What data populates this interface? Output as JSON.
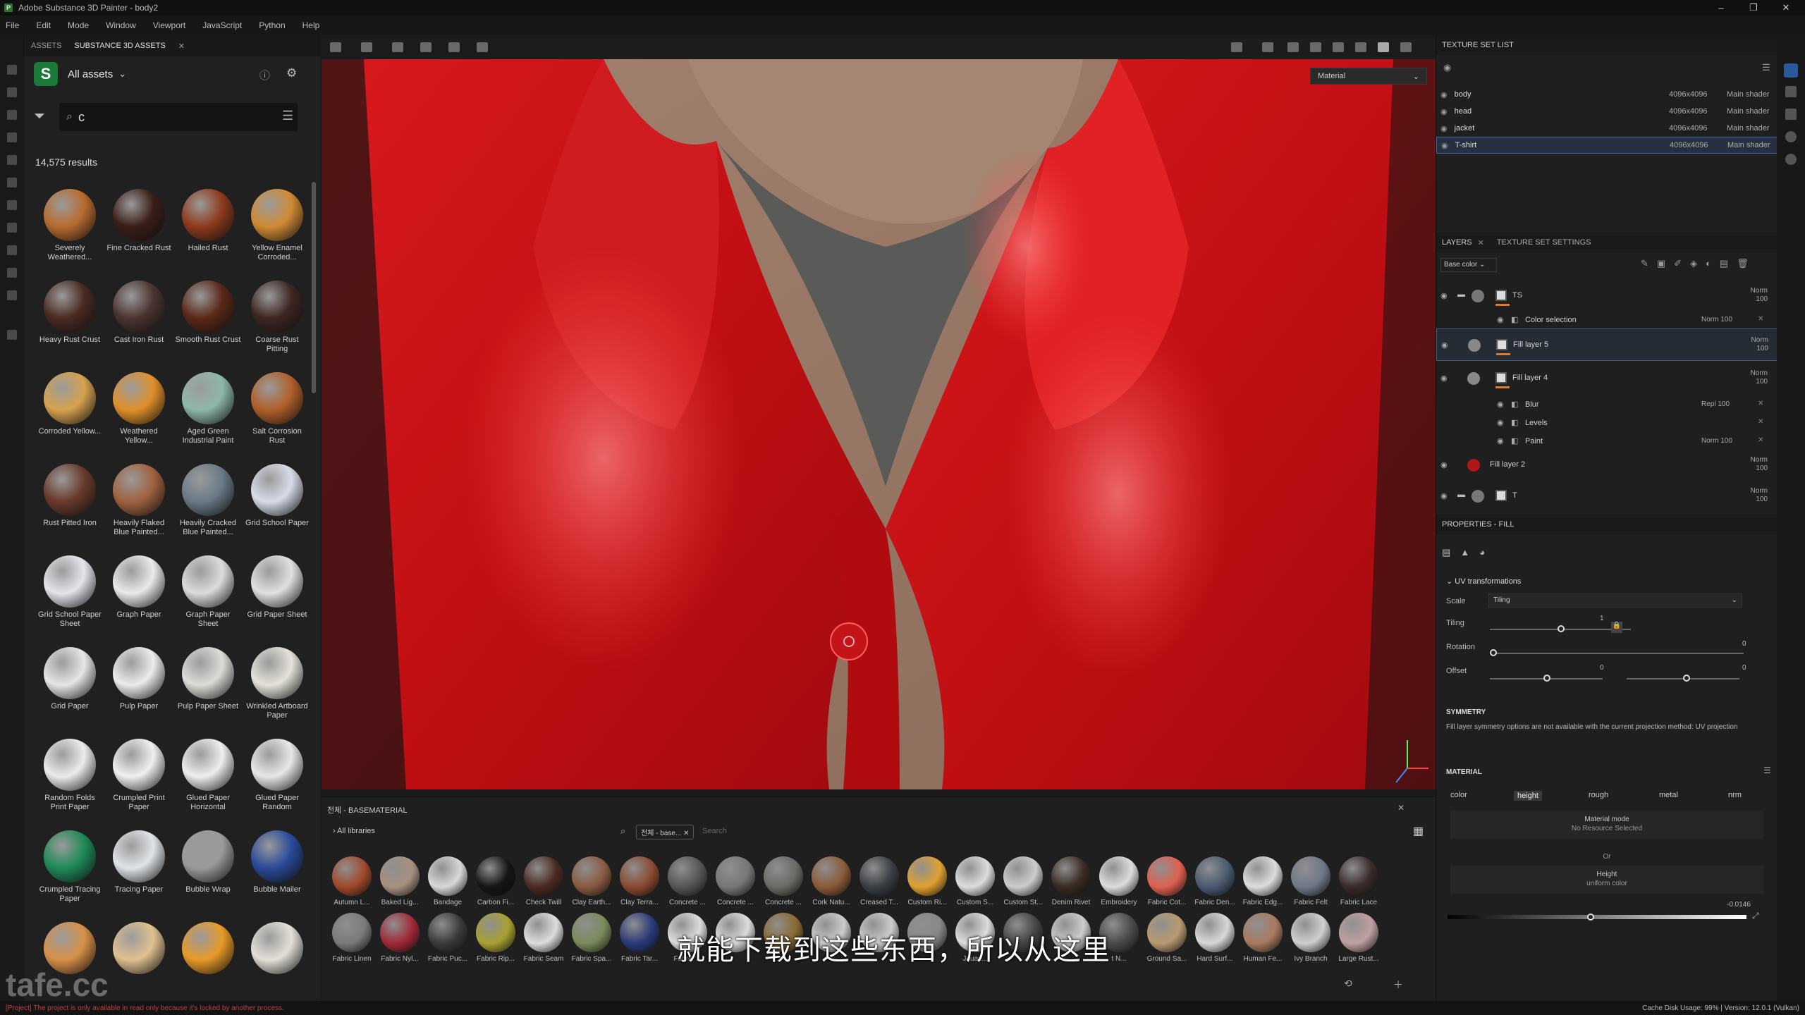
{
  "window": {
    "title": "Adobe Substance 3D Painter - body2"
  },
  "menu": [
    "File",
    "Edit",
    "Mode",
    "Window",
    "Viewport",
    "JavaScript",
    "Python",
    "Help"
  ],
  "assets_panel": {
    "tabs": [
      "ASSETS",
      "SUBSTANCE 3D ASSETS"
    ],
    "library_label": "All assets",
    "search_value": "c",
    "results": "14,575 results",
    "items": [
      {
        "label": "Severely Weathered...",
        "color": "#b86b2e"
      },
      {
        "label": "Fine Cracked Rust",
        "color": "#3a1e18"
      },
      {
        "label": "Hailed Rust",
        "color": "#8e3a1c"
      },
      {
        "label": "Yellow Enamel Corroded...",
        "color": "#d08a34"
      },
      {
        "label": "Heavy Rust Crust",
        "color": "#4a2a22"
      },
      {
        "label": "Cast Iron Rust",
        "color": "#4b3430"
      },
      {
        "label": "Smooth Rust Crust",
        "color": "#5a2818"
      },
      {
        "label": "Coarse Rust Pitting",
        "color": "#3e2622"
      },
      {
        "label": "Corroded Yellow...",
        "color": "#d6a24e"
      },
      {
        "label": "Weathered Yellow...",
        "color": "#e0902a"
      },
      {
        "label": "Aged Green Industrial Paint",
        "color": "#8fb8a8"
      },
      {
        "label": "Salt Corrosion Rust",
        "color": "#b0602a"
      },
      {
        "label": "Rust Pitted Iron",
        "color": "#6a3a2c"
      },
      {
        "label": "Heavily Flaked Blue Painted...",
        "color": "#a06240"
      },
      {
        "label": "Heavily Cracked Blue Painted...",
        "color": "#6a7a88"
      },
      {
        "label": "Grid School Paper",
        "color": "#d8dce8"
      },
      {
        "label": "Grid School Paper Sheet",
        "color": "#e4e6ec"
      },
      {
        "label": "Graph Paper",
        "color": "#e8eaec"
      },
      {
        "label": "Graph Paper Sheet",
        "color": "#dcdcdc"
      },
      {
        "label": "Grid Paper Sheet",
        "color": "#e0e0e0"
      },
      {
        "label": "Grid Paper",
        "color": "#e6e6e6"
      },
      {
        "label": "Pulp Paper",
        "color": "#ececec"
      },
      {
        "label": "Pulp Paper Sheet",
        "color": "#dedcd8"
      },
      {
        "label": "Wrinkled Artboard Paper",
        "color": "#e4e2da"
      },
      {
        "label": "Random Folds Print Paper",
        "color": "#ececec"
      },
      {
        "label": "Crumpled Print Paper",
        "color": "#f0f0f0"
      },
      {
        "label": "Glued Paper Horizontal",
        "color": "#eeeeee"
      },
      {
        "label": "Glued Paper Random",
        "color": "#e8e8e8"
      },
      {
        "label": "Crumpled Tracing Paper",
        "color": "#1f8a58"
      },
      {
        "label": "Tracing Paper",
        "color": "#e0e4e8"
      },
      {
        "label": "Bubble Wrap",
        "color": "#9a9a9a"
      },
      {
        "label": "Bubble Mailer",
        "color": "#2a4a9a"
      },
      {
        "label": "",
        "color": "#d89048"
      },
      {
        "label": "",
        "color": "#e0c090"
      },
      {
        "label": "",
        "color": "#e89a28"
      },
      {
        "label": "",
        "color": "#e4e0d8"
      }
    ]
  },
  "viewport": {
    "material_dropdown": "Material",
    "subtitle": "就能下载到这些东西，所以从这里"
  },
  "shelf": {
    "title": "전체 - BASEMATERIAL",
    "libraries": "All libraries",
    "filter_chip": "전체 - base...",
    "search_placeholder": "Search",
    "row1": [
      {
        "label": "Autumn L...",
        "color": "#a0482a"
      },
      {
        "label": "Baked Lig...",
        "color": "#a89080"
      },
      {
        "label": "Bandage",
        "color": "#d8d8d8"
      },
      {
        "label": "Carbon Fi...",
        "color": "#141414"
      },
      {
        "label": "Check Twill",
        "color": "#4a2a22"
      },
      {
        "label": "Clay Earth...",
        "color": "#8a5a40"
      },
      {
        "label": "Clay Terra...",
        "color": "#8a4a30"
      },
      {
        "label": "Concrete ...",
        "color": "#555555"
      },
      {
        "label": "Concrete ...",
        "color": "#777777"
      },
      {
        "label": "Concrete ...",
        "color": "#6a6a66"
      },
      {
        "label": "Cork Natu...",
        "color": "#8a5a38"
      },
      {
        "label": "Creased T...",
        "color": "#3a3e44"
      },
      {
        "label": "Custom Ri...",
        "color": "#e0a030"
      },
      {
        "label": "Custom S...",
        "color": "#dddddd"
      },
      {
        "label": "Custom St...",
        "color": "#cccccc"
      },
      {
        "label": "Denim Rivet",
        "color": "#3a2a22"
      },
      {
        "label": "Embroidery",
        "color": "#dddddd"
      },
      {
        "label": "Fabric Cot...",
        "color": "#e06050"
      },
      {
        "label": "Fabric Den...",
        "color": "#4a5a70"
      },
      {
        "label": "Fabric Edg...",
        "color": "#dddddd"
      },
      {
        "label": "Fabric Felt",
        "color": "#707888"
      },
      {
        "label": "Fabric Lace",
        "color": "#3a2a2a"
      }
    ],
    "row2": [
      {
        "label": "Fabric Linen",
        "color": "#7a7a78"
      },
      {
        "label": "Fabric Nyl...",
        "color": "#a02838"
      },
      {
        "label": "Fabric Puc...",
        "color": "#3a3a3a"
      },
      {
        "label": "Fabric Rip...",
        "color": "#a8a030"
      },
      {
        "label": "Fabric Seam",
        "color": "#dddddd"
      },
      {
        "label": "Fabric Spa...",
        "color": "#7a8a5a"
      },
      {
        "label": "Fabric Tar...",
        "color": "#2a3a7a"
      },
      {
        "label": "Fabric ...",
        "color": "#dddddd"
      },
      {
        "label": "",
        "color": "#dddddd"
      },
      {
        "label": "",
        "color": "#8a6a30"
      },
      {
        "label": "",
        "color": "#cccccc"
      },
      {
        "label": "",
        "color": "#cccccc"
      },
      {
        "label": "",
        "color": "#888888"
      },
      {
        "label": "Jouac...",
        "color": "#dddddd"
      },
      {
        "label": "",
        "color": "#444444"
      },
      {
        "label": "",
        "color": "#cccccc"
      },
      {
        "label": "t N...",
        "color": "#4a4a4a"
      },
      {
        "label": "Ground Sa...",
        "color": "#b89a70"
      },
      {
        "label": "Hard Surf...",
        "color": "#d8d8d8"
      },
      {
        "label": "Human Fe...",
        "color": "#a87a60"
      },
      {
        "label": "Ivy Branch",
        "color": "#cfcfcf"
      },
      {
        "label": "Large Rust...",
        "color": "#c0a0a0"
      }
    ]
  },
  "texture_set_list": {
    "title": "TEXTURE SET LIST",
    "rows": [
      {
        "name": "body",
        "res": "4096x4096",
        "shader": "Main shader"
      },
      {
        "name": "head",
        "res": "4096x4096",
        "shader": "Main shader"
      },
      {
        "name": "jacket",
        "res": "4096x4096",
        "shader": "Main shader"
      },
      {
        "name": "T-shirt",
        "res": "4096x4096",
        "shader": "Main shader"
      }
    ]
  },
  "layers": {
    "tabs": [
      "LAYERS",
      "TEXTURE SET SETTINGS"
    ],
    "channel": "Base color",
    "rows": [
      {
        "name": "TS",
        "blend": "Norm",
        "opacity": "100"
      },
      {
        "name": "Color selection",
        "blend": "Norm",
        "opacity": "100"
      },
      {
        "name": "Fill layer 5",
        "blend": "Norm",
        "opacity": "100"
      },
      {
        "name": "Fill layer 4",
        "blend": "Norm",
        "opacity": "100"
      },
      {
        "name": "Blur",
        "blend": "Repl",
        "opacity": "100"
      },
      {
        "name": "Levels",
        "blend": "",
        "opacity": ""
      },
      {
        "name": "Paint",
        "blend": "Norm",
        "opacity": "100"
      },
      {
        "name": "Fill layer 2",
        "blend": "Norm",
        "opacity": "100"
      },
      {
        "name": "T",
        "blend": "Norm",
        "opacity": "100"
      }
    ]
  },
  "properties": {
    "title": "PROPERTIES - FILL",
    "uv_section": "UV transformations",
    "scale_label": "Scale",
    "scale_value": "Tiling",
    "tiling_label": "Tiling",
    "tiling_value": "1",
    "rotation_label": "Rotation",
    "rotation_value": "0",
    "offset_label": "Offset",
    "offset_value1": "0",
    "offset_value2": "0",
    "symmetry_title": "SYMMETRY",
    "symmetry_note": "Fill layer symmetry options are not available with the current projection method: UV projection",
    "material_title": "MATERIAL",
    "channels": [
      "color",
      "height",
      "rough",
      "metal",
      "nrm"
    ],
    "material_mode": "Material mode",
    "no_resource": "No Resource Selected",
    "or": "Or",
    "height": "Height",
    "uniform": "uniform color",
    "height_value": "-0.0146"
  },
  "status": {
    "message": "[Project] The project is only available in read only because it's locked by another process.",
    "right": "Cache Disk Usage:  99% | Version: 12.0.1 (Vulkan)"
  },
  "watermark": "tafe.cc"
}
